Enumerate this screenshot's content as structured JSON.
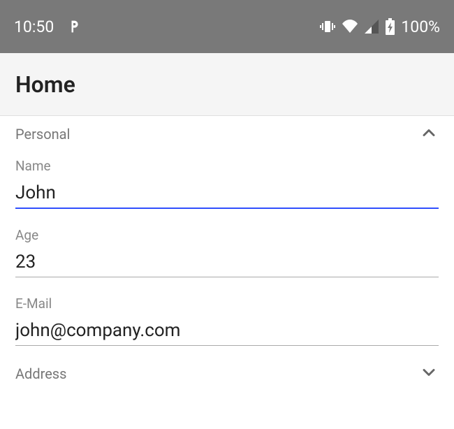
{
  "statusbar": {
    "time": "10:50",
    "battery_percent": "100%"
  },
  "appbar": {
    "title": "Home"
  },
  "sections": {
    "personal": {
      "title": "Personal",
      "expanded": true,
      "fields": {
        "name": {
          "label": "Name",
          "value": "John"
        },
        "age": {
          "label": "Age",
          "value": "23"
        },
        "email": {
          "label": "E-Mail",
          "value": "john@company.com"
        }
      }
    },
    "address": {
      "title": "Address",
      "expanded": false
    }
  }
}
